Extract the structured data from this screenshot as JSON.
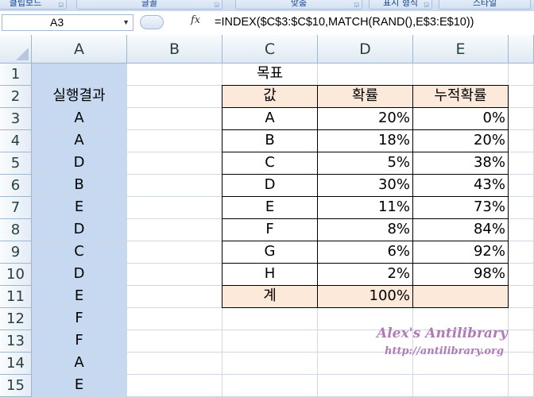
{
  "ribbon": {
    "groups": [
      {
        "label": "클립보드",
        "launcher": "◲"
      },
      {
        "label": "글꼴",
        "launcher": "◲"
      },
      {
        "label": "맞춤",
        "launcher": "◲"
      },
      {
        "label": "표시 형식",
        "launcher": "◲"
      },
      {
        "label": "스타일",
        "launcher": ""
      }
    ]
  },
  "formula_bar": {
    "name_box": "A3",
    "fx_label": "fx",
    "formula": "=INDEX($C$3:$C$10,MATCH(RAND(),E$3:E$10))"
  },
  "columns": [
    "A",
    "B",
    "C",
    "D",
    "E"
  ],
  "rows": [
    "1",
    "2",
    "3",
    "4",
    "5",
    "6",
    "7",
    "8",
    "9",
    "10",
    "11",
    "12",
    "13",
    "14",
    "15"
  ],
  "colA": {
    "header": "실행결과",
    "values": [
      "A",
      "A",
      "D",
      "B",
      "E",
      "D",
      "C",
      "D",
      "E",
      "F",
      "F",
      "A",
      "E"
    ]
  },
  "table": {
    "title": "목표",
    "headers": [
      "값",
      "확률",
      "누적확률"
    ],
    "rows": [
      [
        "A",
        "20%",
        "0%"
      ],
      [
        "B",
        "18%",
        "20%"
      ],
      [
        "C",
        "5%",
        "38%"
      ],
      [
        "D",
        "30%",
        "43%"
      ],
      [
        "E",
        "11%",
        "73%"
      ],
      [
        "F",
        "8%",
        "84%"
      ],
      [
        "G",
        "6%",
        "92%"
      ],
      [
        "H",
        "2%",
        "98%"
      ]
    ],
    "total_label": "계",
    "total_value": "100%"
  },
  "watermark": {
    "title": "Alex's Antilibrary",
    "url": "http://antilibrary.org"
  },
  "colors": {
    "selected_column": "#c6d9f0",
    "header_fill": "#fde9d9",
    "watermark": "#b37ab8"
  }
}
